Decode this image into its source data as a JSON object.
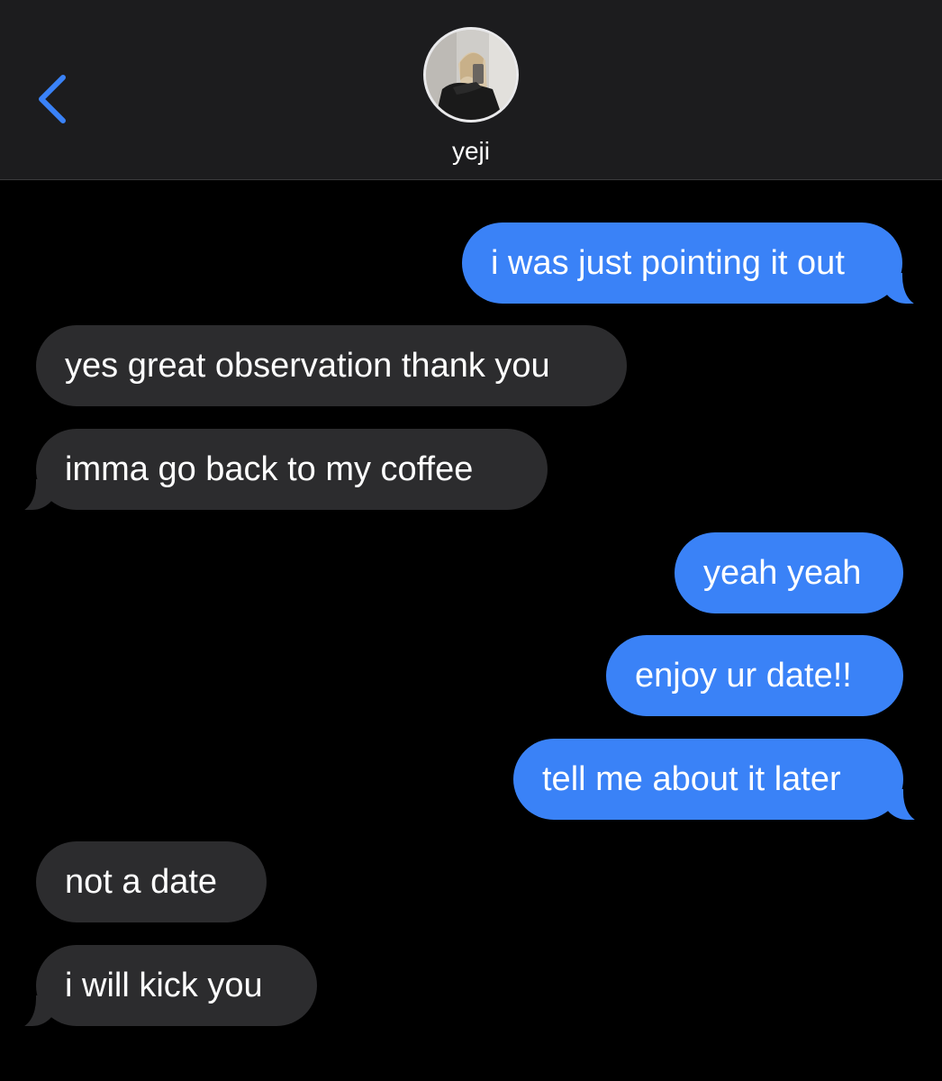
{
  "header": {
    "back_icon": "chevron-left-icon",
    "contact_name": "yeji",
    "avatar_icon": "contact-photo",
    "accent_color": "#3a82f7"
  },
  "messages": [
    {
      "direction": "sent",
      "text": "i was just pointing it out"
    },
    {
      "direction": "received",
      "text": "yes great observation thank you"
    },
    {
      "direction": "received",
      "text": "imma go back to my coffee"
    },
    {
      "direction": "sent",
      "text": "yeah yeah"
    },
    {
      "direction": "sent",
      "text": "enjoy ur date!!"
    },
    {
      "direction": "sent",
      "text": "tell me about it later"
    },
    {
      "direction": "received",
      "text": "not a date"
    },
    {
      "direction": "received",
      "text": "i will kick you"
    }
  ]
}
